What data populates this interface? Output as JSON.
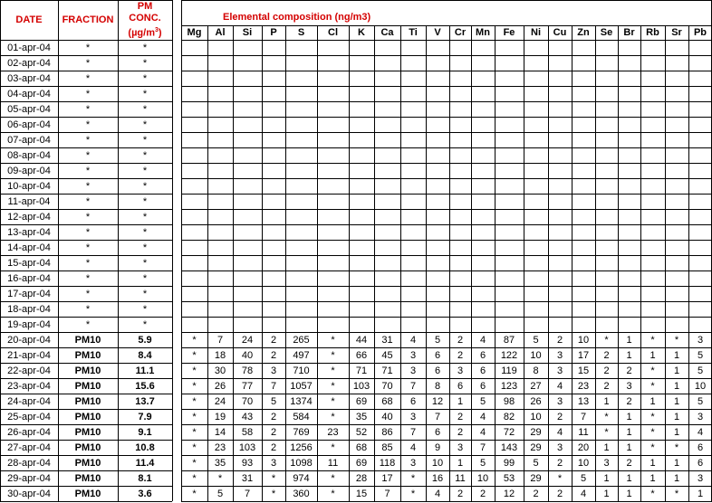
{
  "headers": {
    "date": "DATE",
    "fraction": "FRACTION",
    "pm_line1": "PM",
    "pm_line2": "CONC.",
    "pm_unit_open": "(",
    "pm_unit_mu": "µg/m",
    "pm_unit_sup": "3",
    "pm_unit_close": ")",
    "elemental": "Elemental composition (ng/m3)"
  },
  "elements": [
    "Mg",
    "Al",
    "Si",
    "P",
    "S",
    "Cl",
    "K",
    "Ca",
    "Ti",
    "V",
    "Cr",
    "Mn",
    "Fe",
    "Ni",
    "Cu",
    "Zn",
    "Se",
    "Br",
    "Rb",
    "Sr",
    "Pb"
  ],
  "rows": [
    {
      "date": "01-apr-04",
      "fraction": "*",
      "pm": "*",
      "values": []
    },
    {
      "date": "02-apr-04",
      "fraction": "*",
      "pm": "*",
      "values": []
    },
    {
      "date": "03-apr-04",
      "fraction": "*",
      "pm": "*",
      "values": []
    },
    {
      "date": "04-apr-04",
      "fraction": "*",
      "pm": "*",
      "values": []
    },
    {
      "date": "05-apr-04",
      "fraction": "*",
      "pm": "*",
      "values": []
    },
    {
      "date": "06-apr-04",
      "fraction": "*",
      "pm": "*",
      "values": []
    },
    {
      "date": "07-apr-04",
      "fraction": "*",
      "pm": "*",
      "values": []
    },
    {
      "date": "08-apr-04",
      "fraction": "*",
      "pm": "*",
      "values": []
    },
    {
      "date": "09-apr-04",
      "fraction": "*",
      "pm": "*",
      "values": []
    },
    {
      "date": "10-apr-04",
      "fraction": "*",
      "pm": "*",
      "values": []
    },
    {
      "date": "11-apr-04",
      "fraction": "*",
      "pm": "*",
      "values": []
    },
    {
      "date": "12-apr-04",
      "fraction": "*",
      "pm": "*",
      "values": []
    },
    {
      "date": "13-apr-04",
      "fraction": "*",
      "pm": "*",
      "values": []
    },
    {
      "date": "14-apr-04",
      "fraction": "*",
      "pm": "*",
      "values": []
    },
    {
      "date": "15-apr-04",
      "fraction": "*",
      "pm": "*",
      "values": []
    },
    {
      "date": "16-apr-04",
      "fraction": "*",
      "pm": "*",
      "values": []
    },
    {
      "date": "17-apr-04",
      "fraction": "*",
      "pm": "*",
      "values": []
    },
    {
      "date": "18-apr-04",
      "fraction": "*",
      "pm": "*",
      "values": []
    },
    {
      "date": "19-apr-04",
      "fraction": "*",
      "pm": "*",
      "values": []
    },
    {
      "date": "20-apr-04",
      "fraction": "PM10",
      "pm": "5.9",
      "values": [
        "*",
        "7",
        "24",
        "2",
        "265",
        "*",
        "44",
        "31",
        "4",
        "5",
        "2",
        "4",
        "87",
        "5",
        "2",
        "10",
        "*",
        "1",
        "*",
        "*",
        "3"
      ]
    },
    {
      "date": "21-apr-04",
      "fraction": "PM10",
      "pm": "8.4",
      "values": [
        "*",
        "18",
        "40",
        "2",
        "497",
        "*",
        "66",
        "45",
        "3",
        "6",
        "2",
        "6",
        "122",
        "10",
        "3",
        "17",
        "2",
        "1",
        "1",
        "1",
        "5"
      ]
    },
    {
      "date": "22-apr-04",
      "fraction": "PM10",
      "pm": "11.1",
      "values": [
        "*",
        "30",
        "78",
        "3",
        "710",
        "*",
        "71",
        "71",
        "3",
        "6",
        "3",
        "6",
        "119",
        "8",
        "3",
        "15",
        "2",
        "2",
        "*",
        "1",
        "5"
      ]
    },
    {
      "date": "23-apr-04",
      "fraction": "PM10",
      "pm": "15.6",
      "values": [
        "*",
        "26",
        "77",
        "7",
        "1057",
        "*",
        "103",
        "70",
        "7",
        "8",
        "6",
        "6",
        "123",
        "27",
        "4",
        "23",
        "2",
        "3",
        "*",
        "1",
        "10"
      ]
    },
    {
      "date": "24-apr-04",
      "fraction": "PM10",
      "pm": "13.7",
      "values": [
        "*",
        "24",
        "70",
        "5",
        "1374",
        "*",
        "69",
        "68",
        "6",
        "12",
        "1",
        "5",
        "98",
        "26",
        "3",
        "13",
        "1",
        "2",
        "1",
        "1",
        "5"
      ]
    },
    {
      "date": "25-apr-04",
      "fraction": "PM10",
      "pm": "7.9",
      "values": [
        "*",
        "19",
        "43",
        "2",
        "584",
        "*",
        "35",
        "40",
        "3",
        "7",
        "2",
        "4",
        "82",
        "10",
        "2",
        "7",
        "*",
        "1",
        "*",
        "1",
        "3"
      ]
    },
    {
      "date": "26-apr-04",
      "fraction": "PM10",
      "pm": "9.1",
      "values": [
        "*",
        "14",
        "58",
        "2",
        "769",
        "23",
        "52",
        "86",
        "7",
        "6",
        "2",
        "4",
        "72",
        "29",
        "4",
        "11",
        "*",
        "1",
        "*",
        "1",
        "4"
      ]
    },
    {
      "date": "27-apr-04",
      "fraction": "PM10",
      "pm": "10.8",
      "values": [
        "*",
        "23",
        "103",
        "2",
        "1256",
        "*",
        "68",
        "85",
        "4",
        "9",
        "3",
        "7",
        "143",
        "29",
        "3",
        "20",
        "1",
        "1",
        "*",
        "*",
        "6"
      ]
    },
    {
      "date": "28-apr-04",
      "fraction": "PM10",
      "pm": "11.4",
      "values": [
        "*",
        "35",
        "93",
        "3",
        "1098",
        "11",
        "69",
        "118",
        "3",
        "10",
        "1",
        "5",
        "99",
        "5",
        "2",
        "10",
        "3",
        "2",
        "1",
        "1",
        "6"
      ]
    },
    {
      "date": "29-apr-04",
      "fraction": "PM10",
      "pm": "8.1",
      "values": [
        "*",
        "*",
        "31",
        "*",
        "974",
        "*",
        "28",
        "17",
        "*",
        "16",
        "11",
        "10",
        "53",
        "29",
        "*",
        "5",
        "1",
        "1",
        "1",
        "1",
        "3"
      ]
    },
    {
      "date": "30-apr-04",
      "fraction": "PM10",
      "pm": "3.6",
      "values": [
        "*",
        "5",
        "7",
        "*",
        "360",
        "*",
        "15",
        "7",
        "*",
        "4",
        "2",
        "2",
        "12",
        "2",
        "2",
        "4",
        "1",
        "1",
        "*",
        "*",
        "1"
      ]
    }
  ]
}
